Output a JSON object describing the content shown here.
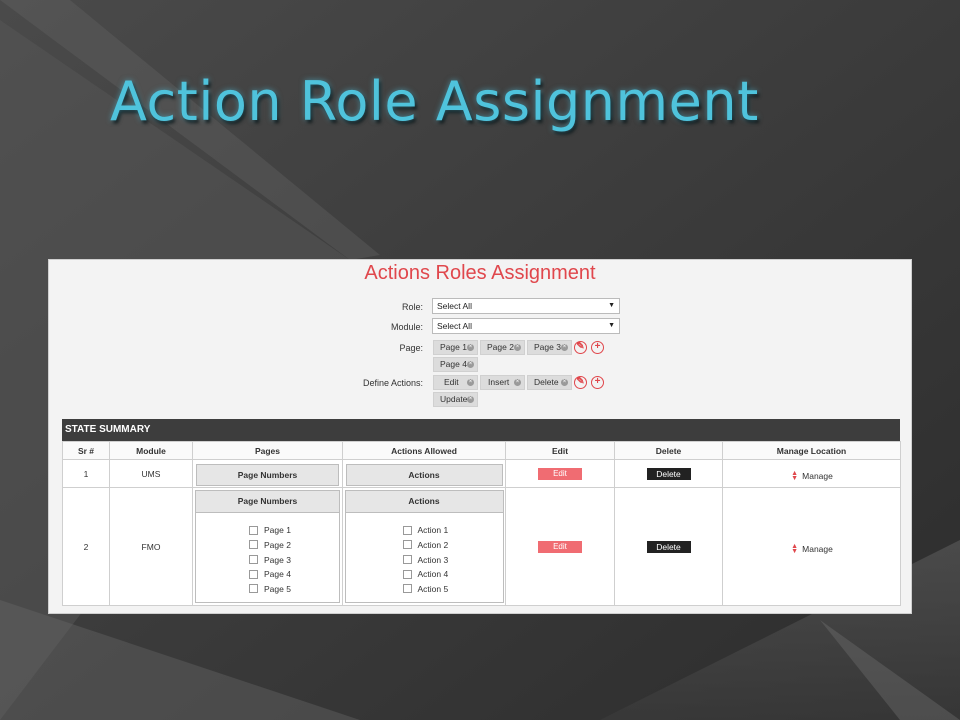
{
  "slide": {
    "title": "Action Role Assignment"
  },
  "form": {
    "title": "Actions Roles Assignment",
    "role": {
      "label": "Role:",
      "value": "Select All"
    },
    "module": {
      "label": "Module:",
      "value": "Select All"
    },
    "page": {
      "label": "Page:",
      "chips": [
        "Page 1",
        "Page 2",
        "Page 3",
        "Page 4"
      ]
    },
    "actions": {
      "label": "Define Actions:",
      "chips": [
        "Edit",
        "Insert",
        "Delete",
        "Update"
      ]
    }
  },
  "summary": {
    "title": "STATE SUMMARY",
    "columns": [
      "Sr #",
      "Module",
      "Pages",
      "Actions Allowed",
      "Edit",
      "Delete",
      "Manage Location"
    ],
    "rows": [
      {
        "sr": "1",
        "module": "UMS",
        "pages_head": "Page Numbers",
        "actions_head": "Actions",
        "edit": "Edit",
        "delete": "Delete",
        "manage": "Manage"
      },
      {
        "sr": "2",
        "module": "FMO",
        "pages_head": "Page Numbers",
        "actions_head": "Actions",
        "pages": [
          "Page 1",
          "Page 2",
          "Page 3",
          "Page 4",
          "Page 5"
        ],
        "actions": [
          "Action 1",
          "Action 2",
          "Action 3",
          "Action 4",
          "Action 5"
        ],
        "edit": "Edit",
        "delete": "Delete",
        "manage": "Manage"
      }
    ]
  },
  "colors": {
    "accent": "#e0474c",
    "edit_button": "#f06c72",
    "title": "#4fc3dc"
  }
}
